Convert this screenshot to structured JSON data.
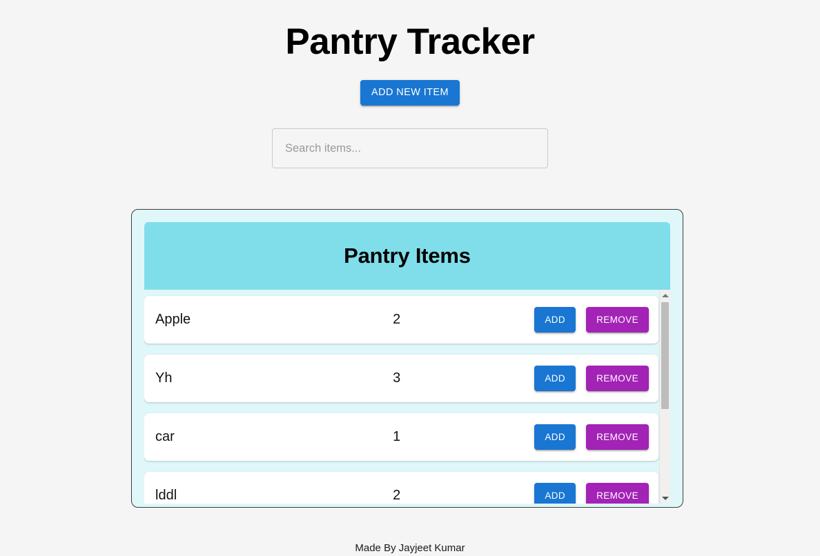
{
  "page": {
    "title": "Pantry Tracker",
    "background_color": "#f5f5f5"
  },
  "toolbar": {
    "add_new_item_label": "ADD NEW ITEM",
    "add_new_item_color": "#1976d2"
  },
  "search": {
    "value": "",
    "placeholder": "Search items..."
  },
  "panel": {
    "header_title": "Pantry Items",
    "header_color": "#80deea",
    "container_color": "#e0f7fa",
    "border_color": "#3b3b3b"
  },
  "actions": {
    "add_label": "ADD",
    "remove_label": "REMOVE",
    "add_color": "#1976d2",
    "remove_color": "#a223b5"
  },
  "items": [
    {
      "name": "Apple",
      "quantity": "2"
    },
    {
      "name": "Yh",
      "quantity": "3"
    },
    {
      "name": "car",
      "quantity": "1"
    },
    {
      "name": "lddl",
      "quantity": "2"
    }
  ],
  "scrollbar": {
    "up_arrow": "triangle-up-icon",
    "down_arrow": "triangle-down-icon",
    "thumb_position": "top"
  },
  "footer": {
    "credit": "Made By Jayjeet Kumar"
  }
}
